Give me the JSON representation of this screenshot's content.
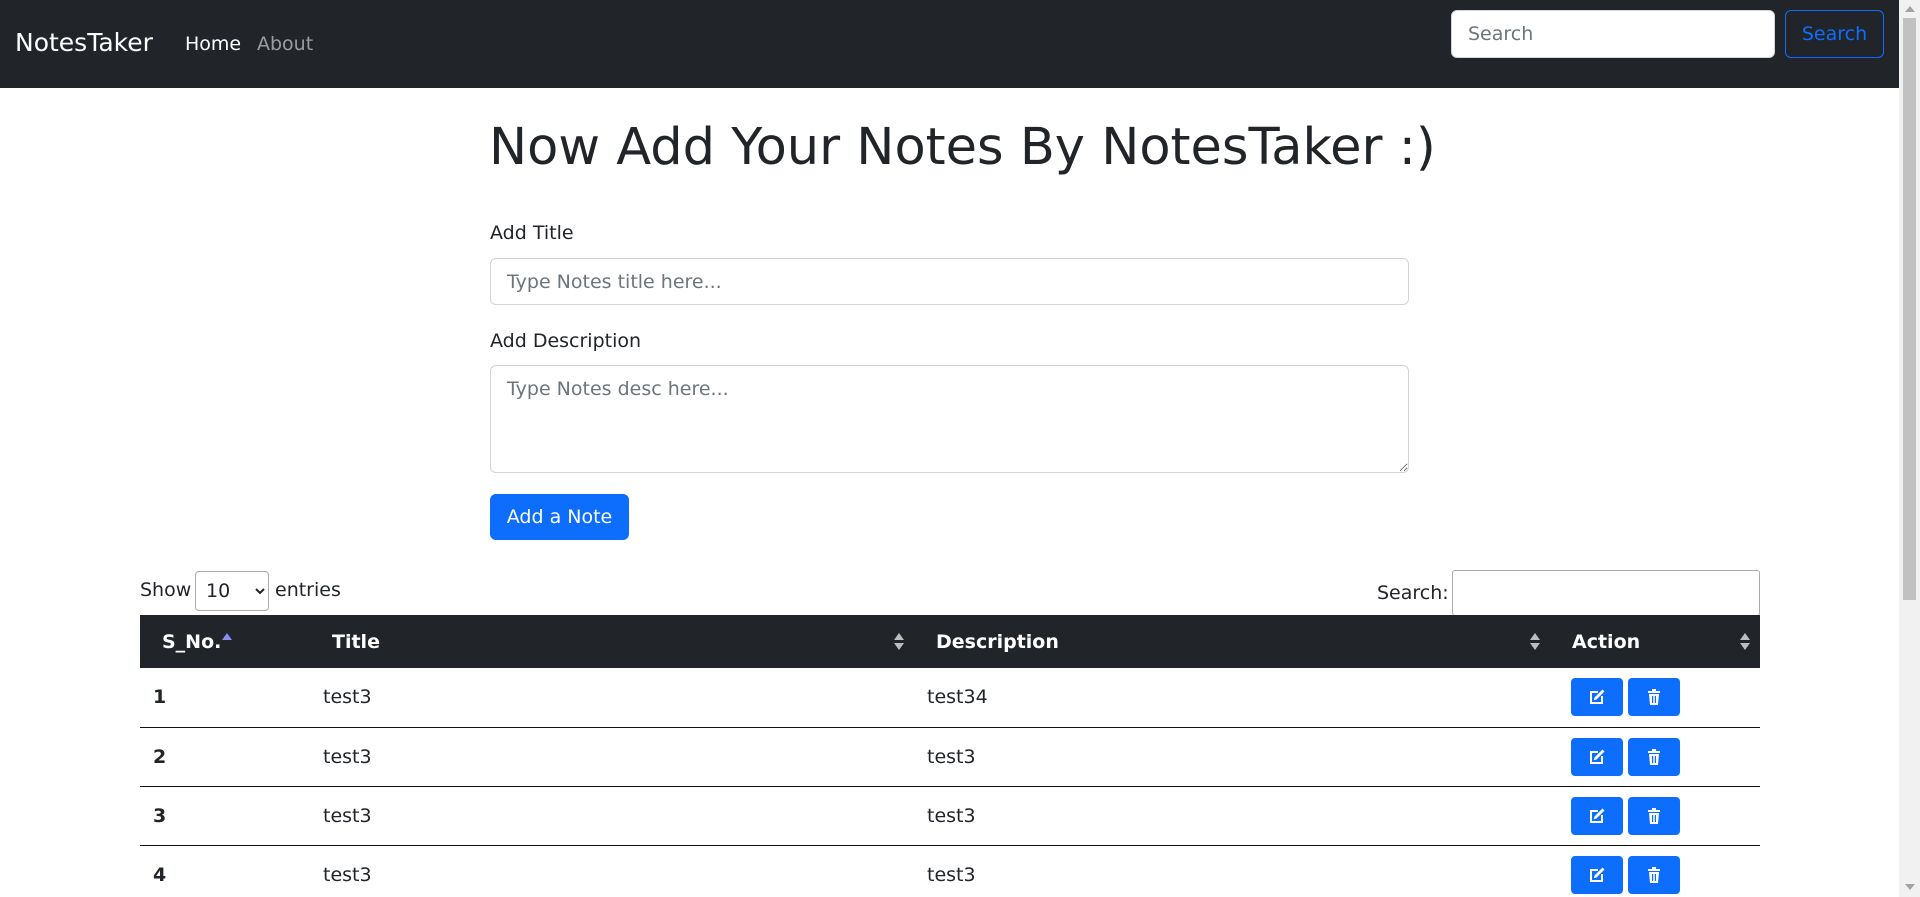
{
  "navbar": {
    "brand": "NotesTaker",
    "links": [
      "Home",
      "About"
    ],
    "search_placeholder": "Search",
    "search_button": "Search"
  },
  "form": {
    "heading": "Now Add Your Notes By NotesTaker :)",
    "title_label": "Add Title",
    "title_placeholder": "Type Notes title here...",
    "desc_label": "Add Description",
    "desc_placeholder": "Type Notes desc here...",
    "submit_label": "Add a Note"
  },
  "datatable": {
    "show_label": "Show",
    "page_length": "10",
    "entries_label": "entries",
    "search_label": "Search:",
    "columns": [
      "S_No.",
      "Title",
      "Description",
      "Action"
    ],
    "sorted_column": "S_No.",
    "rows": [
      {
        "sno": "1",
        "title": "test3",
        "description": "test34"
      },
      {
        "sno": "2",
        "title": "test3",
        "description": "test3"
      },
      {
        "sno": "3",
        "title": "test3",
        "description": "test3"
      },
      {
        "sno": "4",
        "title": "test3",
        "description": "test3"
      }
    ],
    "row_actions": [
      "edit-icon",
      "trash-icon"
    ]
  },
  "colors": {
    "navbar_bg": "#212529",
    "primary": "#0d6efd",
    "header_bg": "#212529"
  }
}
